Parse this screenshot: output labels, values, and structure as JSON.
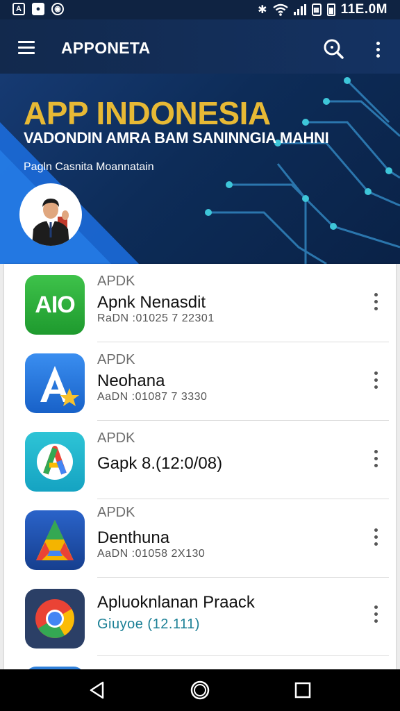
{
  "status_bar": {
    "time": "11E.0M"
  },
  "app_bar": {
    "title": "APPONETA"
  },
  "banner": {
    "title": "APP INDONESIA",
    "subtitle": "VADONDIN AMRA BAM SANINNGIA MAHNI",
    "tagline": "Pagln Casnita Moannatain"
  },
  "apps": [
    {
      "category": "APDK",
      "name": "Apnk Nenasdit",
      "meta": "RaDN :01025 7 22301",
      "icon": "aio-app-icon",
      "icon_text": "AIO"
    },
    {
      "category": "APDK",
      "name": "Neohana",
      "meta": "AaDN :01087 7 3330",
      "icon": "a-star-app-icon"
    },
    {
      "category": "APDK",
      "name": "Gapk 8.(12:0/08)",
      "meta": "",
      "icon": "colorful-a-app-icon"
    },
    {
      "category": "APDK",
      "name": "Denthuna",
      "meta": "AaDN :01058 2X130",
      "icon": "triangle-a-app-icon"
    },
    {
      "category": "",
      "name": "Apluoknlanan Praack",
      "meta": "Giuyoe (12.111)",
      "icon": "chrome-app-icon"
    }
  ],
  "colors": {
    "accent_gold": "#e7b935",
    "app_bar": "#12294d",
    "meta_link": "#1a7f95"
  }
}
